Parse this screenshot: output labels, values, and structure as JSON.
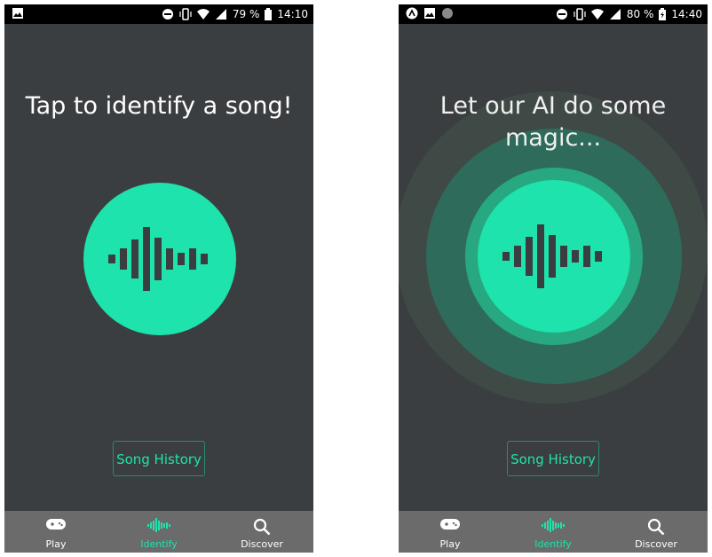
{
  "left": {
    "status": {
      "battery_pct": "79 %",
      "time": "14:10"
    },
    "headline": "Tap to identify a song!",
    "history_button": "Song History"
  },
  "right": {
    "status": {
      "battery_pct": "80 %",
      "time": "14:40"
    },
    "headline": "Let our AI do some magic...",
    "history_button": "Song History"
  },
  "nav": {
    "play": "Play",
    "identify": "Identify",
    "discover": "Discover"
  },
  "colors": {
    "accent": "#1ee3ac",
    "background": "#3b3e40",
    "navbar": "#6b6b6b"
  }
}
